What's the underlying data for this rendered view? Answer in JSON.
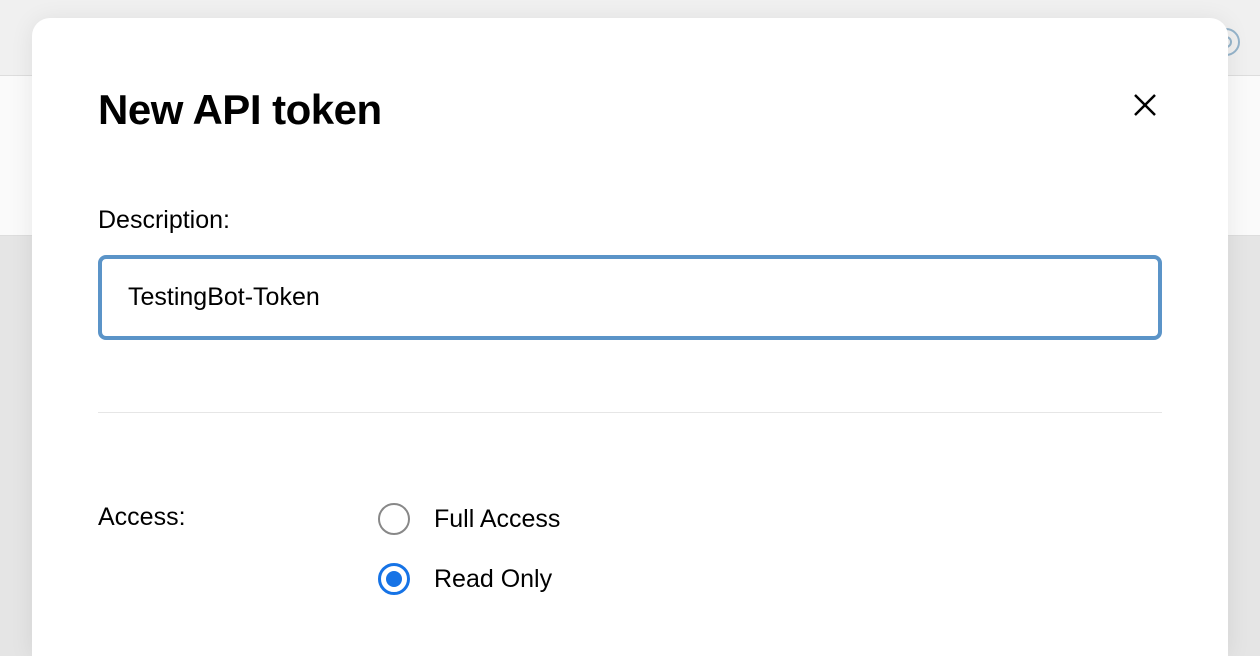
{
  "modal": {
    "title": "New API token",
    "close_label": "Close"
  },
  "description": {
    "label": "Description:",
    "value": "TestingBot-Token"
  },
  "access": {
    "label": "Access:",
    "options": [
      {
        "label": "Full Access",
        "selected": false
      },
      {
        "label": "Read Only",
        "selected": true
      }
    ]
  }
}
